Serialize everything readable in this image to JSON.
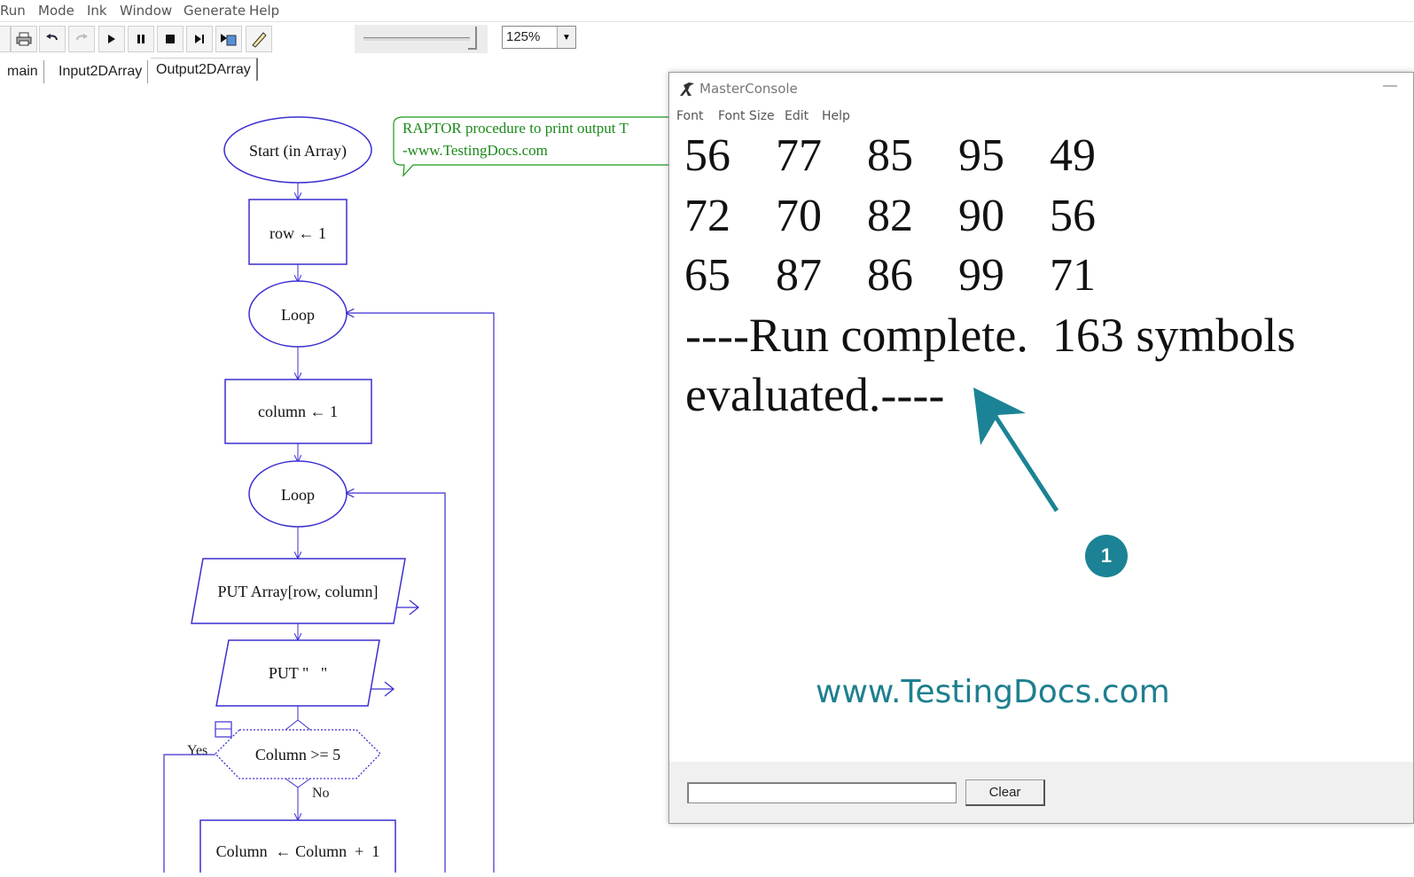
{
  "menubar": {
    "items": [
      "Run",
      "Mode",
      "Ink",
      "Window",
      "Generate",
      "Help"
    ]
  },
  "toolbar": {
    "buttons": [
      "print-icon",
      "undo-icon",
      "redo-icon",
      "play-icon",
      "pause-icon",
      "stop-icon",
      "step-icon",
      "test-server-icon",
      "pen-icon"
    ],
    "zoom_value": "125%"
  },
  "tabs": [
    "main",
    "Input2DArray",
    "Output2DArray"
  ],
  "flowchart": {
    "comment_line1": "RAPTOR procedure to print output T",
    "comment_line2": "-www.TestingDocs.com",
    "start": "Start (in Array)",
    "assign_row": "row ← 1",
    "loop1": "Loop",
    "assign_column": "column ← 1",
    "loop2": "Loop",
    "put1": "PUT Array[row, column]",
    "put2": "PUT \"   \"",
    "decision": "Column >= 5",
    "yes_label": "Yes",
    "no_label": "No",
    "assign_increment": "Column  ← Column  +  1"
  },
  "console": {
    "title": "MasterConsole",
    "menu": [
      "Font",
      "Font Size",
      "Edit",
      "Help"
    ],
    "rows": [
      [
        "56",
        "77",
        "85",
        "95",
        "49"
      ],
      [
        "72",
        "70",
        "82",
        "90",
        "56"
      ],
      [
        "65",
        "87",
        "86",
        "99",
        "71"
      ]
    ],
    "status_line1": "----Run complete.  163 symbols",
    "status_line2": "evaluated.----",
    "clear_label": "Clear"
  },
  "watermark": "www.TestingDocs.com",
  "callout_number": "1",
  "colors": {
    "flow_stroke": "#3a2fd0",
    "comment_stroke": "#1a9a1a",
    "accent": "#1b8395"
  }
}
